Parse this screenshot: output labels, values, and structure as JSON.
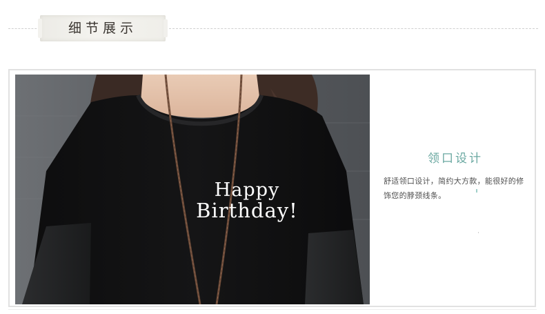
{
  "header": {
    "title": "细节展示"
  },
  "photo": {
    "description_icon": "photo",
    "print_line1": "Happy",
    "print_line2": "Birthday!"
  },
  "feature": {
    "title": "领口设计",
    "description": "舒适领口设计，简约大方款，能很好的修饰您的脖颈线条。"
  },
  "colors": {
    "accent": "#6aa8a1",
    "text": "#4f4f4f",
    "frame": "#e1e1e1"
  }
}
